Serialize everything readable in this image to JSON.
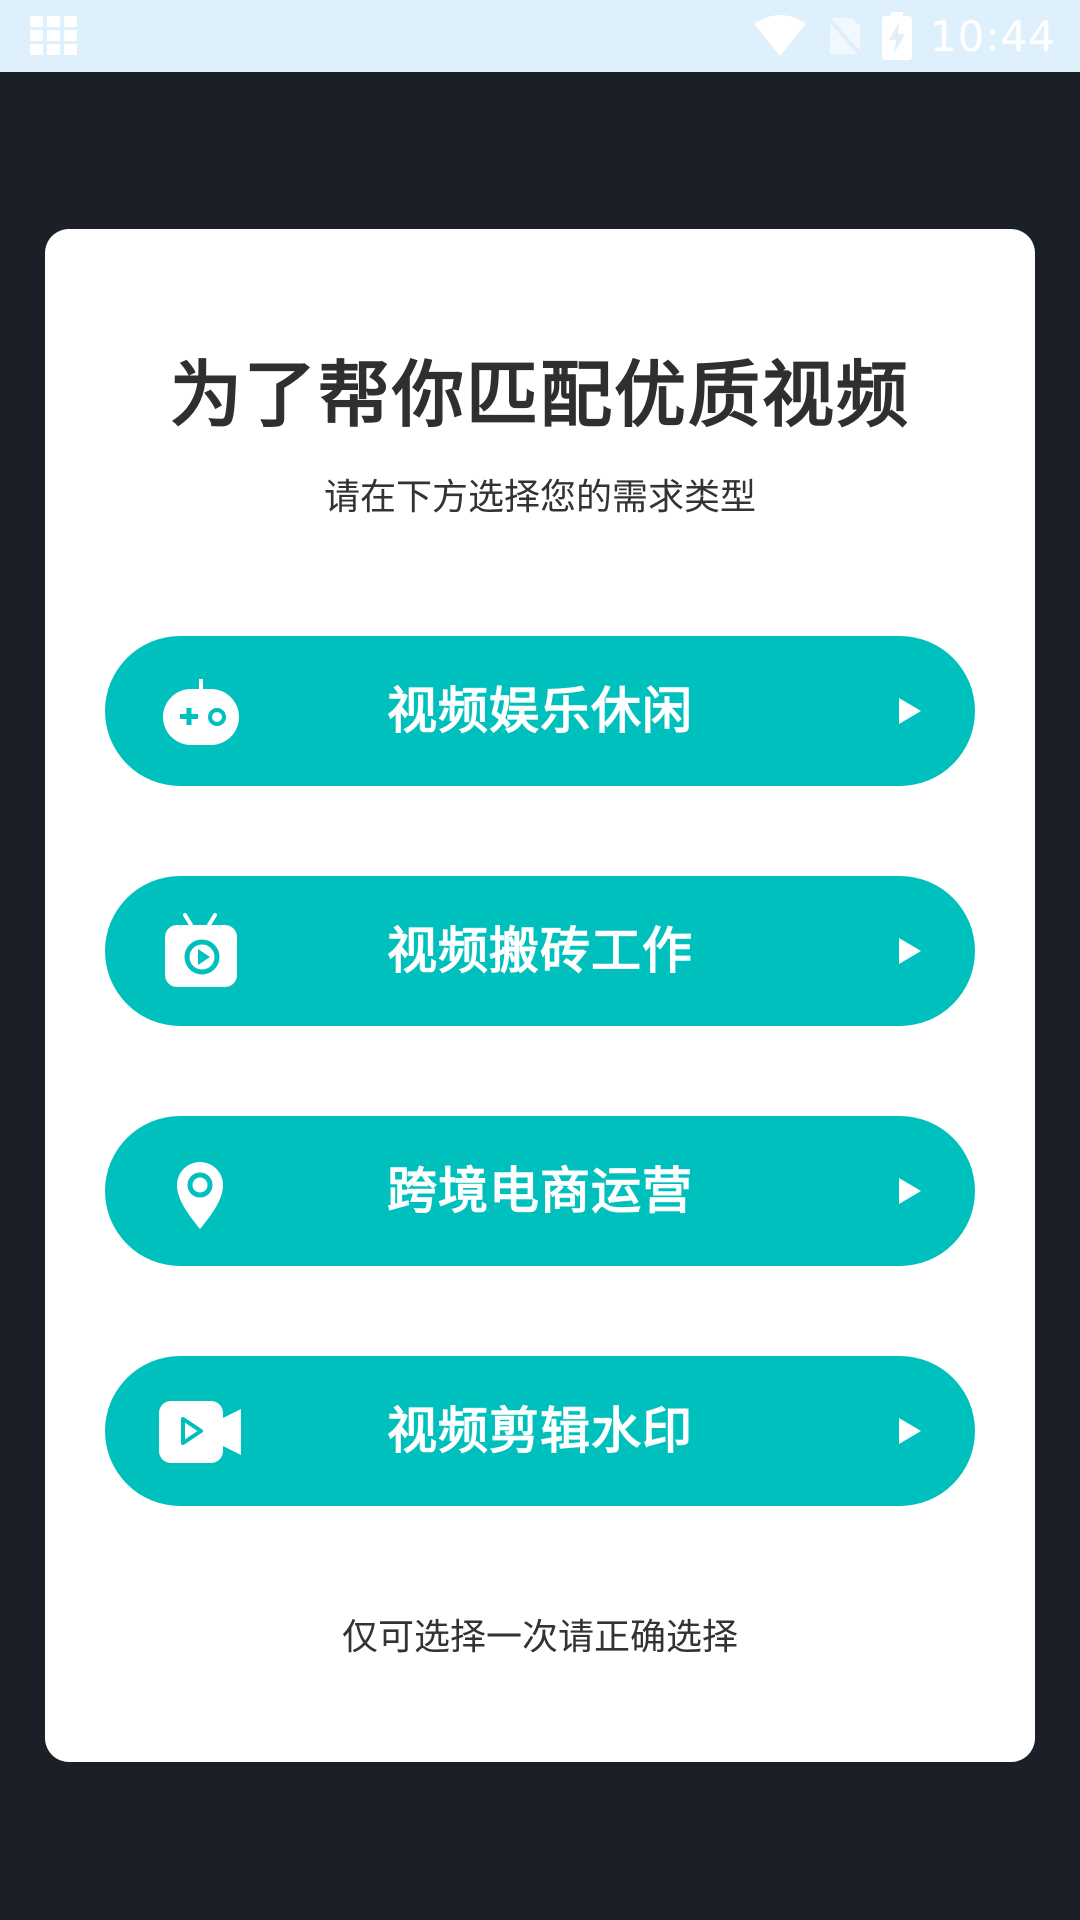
{
  "status_bar": {
    "time": "10:44",
    "icons": [
      "app-grid-icon",
      "wifi-icon",
      "no-sim-icon",
      "battery-charging-icon"
    ]
  },
  "dialog": {
    "title": "为了帮你匹配优质视频",
    "subtitle": "请在下方选择您的需求类型",
    "options": [
      {
        "label": "视频娱乐休闲",
        "icon": "gamepad-icon"
      },
      {
        "label": "视频搬砖工作",
        "icon": "tv-play-icon"
      },
      {
        "label": "跨境电商运营",
        "icon": "location-pin-icon"
      },
      {
        "label": "视频剪辑水印",
        "icon": "video-camera-icon"
      }
    ],
    "footnote": "仅可选择一次请正确选择"
  },
  "colors": {
    "background": "#1b1f27",
    "status_bar": "#dff0fd",
    "accent": "#00c0bd",
    "card": "#ffffff",
    "title_text": "#2f2f2f"
  }
}
